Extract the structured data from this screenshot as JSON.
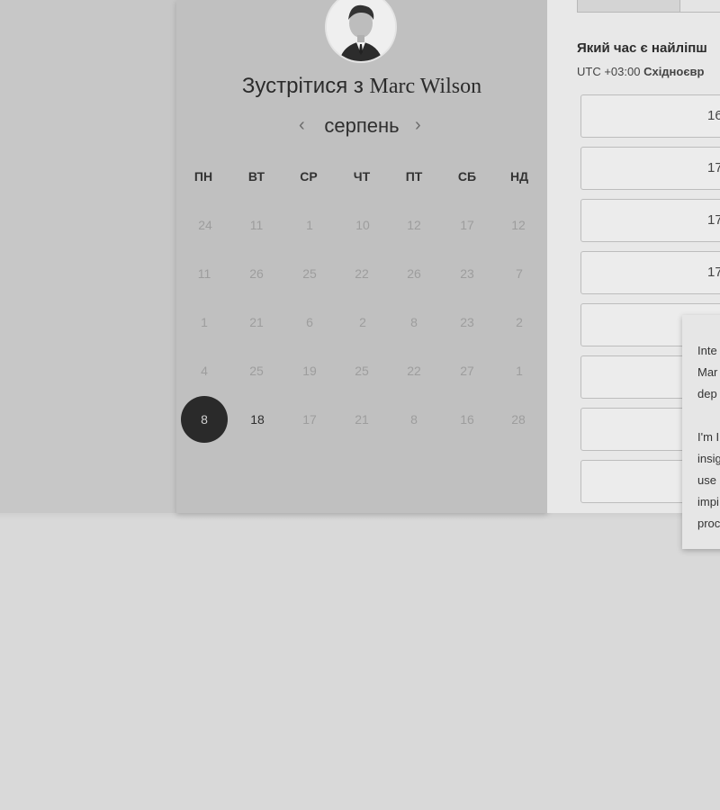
{
  "host": {
    "title_prefix": "Зустрітися з",
    "name": "Marc Wilson"
  },
  "calendar": {
    "month": "серпень",
    "prev_icon": "chevron-left-icon",
    "next_icon": "chevron-right-icon",
    "weekdays": [
      "ПН",
      "ВТ",
      "СР",
      "ЧТ",
      "ПТ",
      "СБ",
      "НД"
    ],
    "weeks": [
      [
        "24",
        "11",
        "1",
        "10",
        "12",
        "17",
        "12"
      ],
      [
        "11",
        "26",
        "25",
        "22",
        "26",
        "23",
        "7"
      ],
      [
        "1",
        "21",
        "6",
        "2",
        "8",
        "23",
        "2"
      ],
      [
        "4",
        "25",
        "19",
        "25",
        "22",
        "27",
        "1"
      ],
      [
        "8",
        "18",
        "17",
        "21",
        "8",
        "16",
        "28"
      ]
    ],
    "selected_day": "8",
    "available_days": [
      "18"
    ]
  },
  "scheduler": {
    "question": "Який час є найліпш",
    "timezone_offset": "UTC +03:00",
    "timezone_name": "Східноєвр",
    "slots": [
      "16",
      "17",
      "17",
      "17",
      "",
      "",
      "",
      ""
    ]
  },
  "popover": {
    "lines": [
      "Inte",
      "Mar",
      "dep",
      "",
      "I'm I",
      "insig",
      "use",
      "impi",
      "proc"
    ]
  }
}
